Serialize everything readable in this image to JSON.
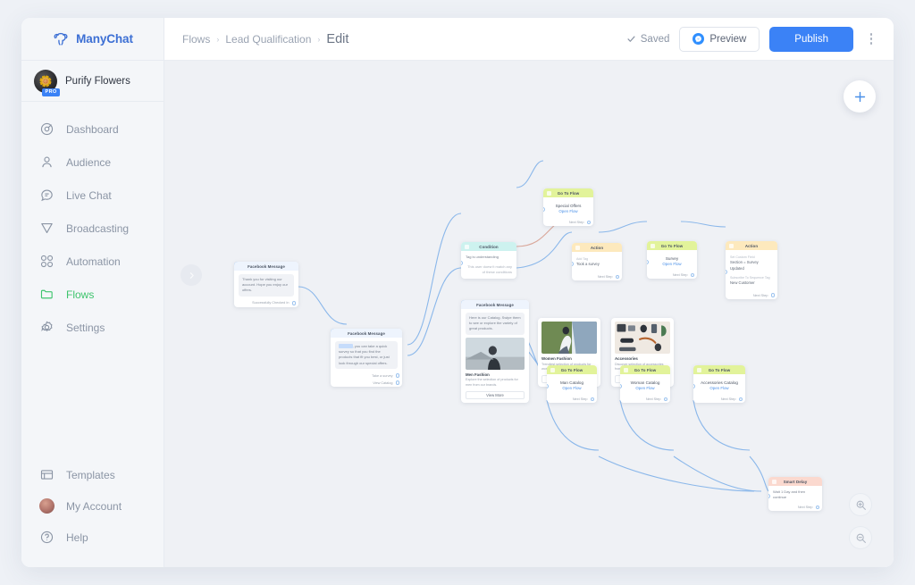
{
  "brand": {
    "name": "ManyChat",
    "logo_icon": "manychat-logo-icon"
  },
  "account": {
    "name": "Purify Flowers",
    "badge": "PRO"
  },
  "sidebar": {
    "items": [
      {
        "label": "Dashboard",
        "icon": "dashboard-icon",
        "active": false
      },
      {
        "label": "Audience",
        "icon": "audience-icon",
        "active": false
      },
      {
        "label": "Live Chat",
        "icon": "live-chat-icon",
        "active": false
      },
      {
        "label": "Broadcasting",
        "icon": "broadcasting-icon",
        "active": false
      },
      {
        "label": "Automation",
        "icon": "automation-icon",
        "active": false
      },
      {
        "label": "Flows",
        "icon": "flows-icon",
        "active": true
      },
      {
        "label": "Settings",
        "icon": "settings-icon",
        "active": false
      }
    ],
    "bottom_items": [
      {
        "label": "Templates",
        "icon": "templates-icon"
      },
      {
        "label": "My Account",
        "icon": "my-account-avatar-icon"
      },
      {
        "label": "Help",
        "icon": "help-icon"
      }
    ]
  },
  "topbar": {
    "breadcrumb": [
      "Flows",
      "Lead Qualification",
      "Edit"
    ],
    "separator": "›",
    "saved_label": "Saved",
    "preview_label": "Preview",
    "publish_label": "Publish",
    "more_icon": "kebab-menu-icon"
  },
  "canvas": {
    "add_icon": "plus-icon",
    "zoom_in_icon": "zoom-in-icon",
    "zoom_out_icon": "zoom-out-icon",
    "collapse_icon": "chevron-right-icon",
    "accent_color": "#3b82f6",
    "background_color": "#eff1f5"
  },
  "nodes": {
    "welcome": {
      "type": "Facebook Message",
      "text": "Thank you for visiting our account. Hope you enjoy our offers.",
      "port": "Successfully Checked In"
    },
    "intro": {
      "type": "Facebook Message",
      "highlight": "Hi Name",
      "text": ", you can take a quick survey so that you find the products that fit you best, or just look through our special offers.",
      "port1": "Take a survey",
      "port2": "View Catalog"
    },
    "condition": {
      "type": "Condition",
      "line": "Tag is understanding",
      "note": "This user doesn't match any of these conditions"
    },
    "special_offers": {
      "type": "Go To Flow",
      "title": "Special Offers",
      "link": "Open Flow",
      "port": "Next Step"
    },
    "action_survey": {
      "type": "Action",
      "key": "Add Tag",
      "value": "Took a survey",
      "port": "Next Step"
    },
    "goto_survey": {
      "type": "Go To Flow",
      "title": "Survey",
      "link": "Open Flow",
      "port": "Next Step"
    },
    "action_customer": {
      "type": "Action",
      "key1": "Set Custom Field",
      "value1": "Section = Survey Updated",
      "key2": "Subscribe To Sequence Tag",
      "value2": "New Customer",
      "port": "Next Step"
    },
    "gallery": {
      "type": "Facebook Message",
      "intro": "Here is our Catalog. Swipe them to see or explore the variety of great products.",
      "cards": [
        {
          "title": "Men Fashion",
          "desc": "Explore the selection of products for men from our brands.",
          "button": "View More"
        },
        {
          "title": "Women Fashion",
          "desc": "Trendiest selection of products for women from our brands.",
          "button": "View More"
        },
        {
          "title": "Accessories",
          "desc": "Discover selection of accessories from well known brands.",
          "button": "View More"
        }
      ]
    },
    "catalogs": [
      {
        "type": "Go To Flow",
        "title": "Man Catalog",
        "link": "Open Flow",
        "port": "Next Step"
      },
      {
        "type": "Go To Flow",
        "title": "Woman Catalog",
        "link": "Open Flow",
        "port": "Next Step"
      },
      {
        "type": "Go To Flow",
        "title": "Accessories Catalog",
        "link": "Open Flow",
        "port": "Next Step"
      }
    ],
    "smart_delay": {
      "type": "Smart Delay",
      "text": "Wait 1 Day and then continue",
      "port": "Next Step"
    }
  }
}
